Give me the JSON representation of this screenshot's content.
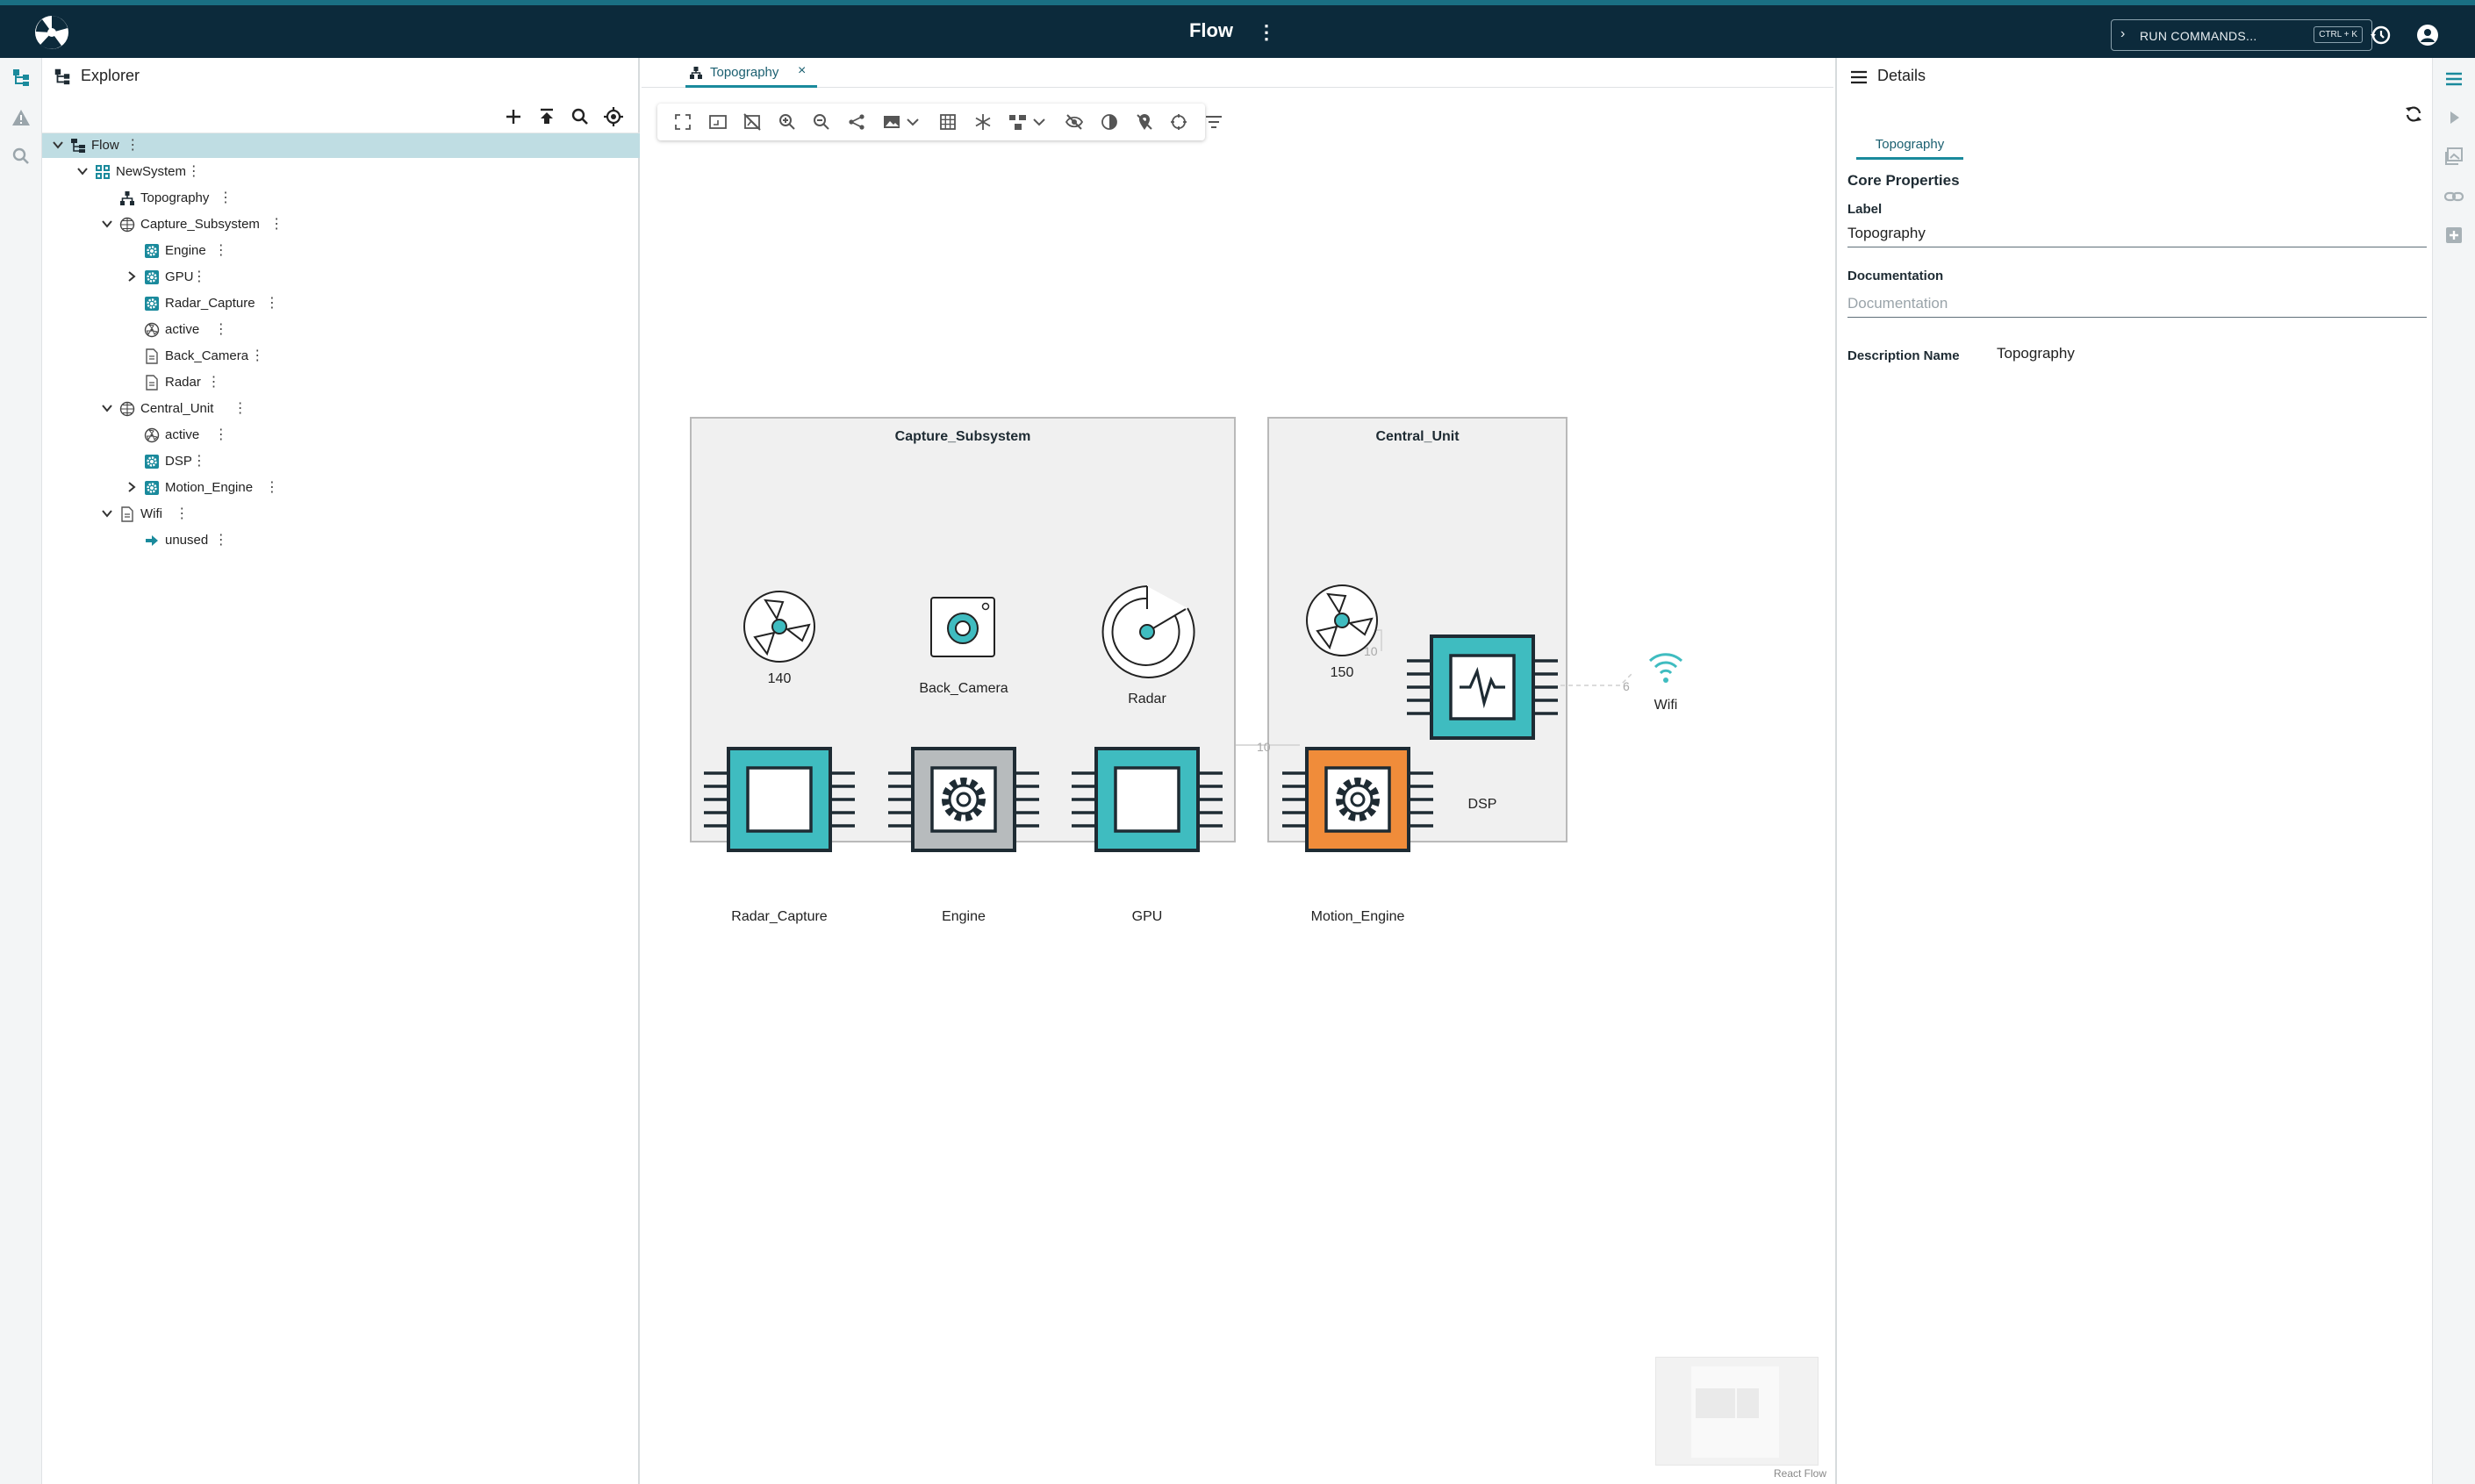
{
  "topbar": {
    "title": "Flow",
    "menu_glyph": "⋮",
    "run_commands_label": "RUN COMMANDS...",
    "run_commands_shortcut": "CTRL + K",
    "logo_icon": "aperture-logo",
    "history_icon": "history-icon",
    "account_icon": "account-circle-icon"
  },
  "left_rail": {
    "items": [
      {
        "name": "explorer-view",
        "icon": "tree-icon",
        "active": true
      },
      {
        "name": "problems-view",
        "icon": "warning-icon",
        "active": false
      },
      {
        "name": "search-view",
        "icon": "search-icon",
        "active": false
      }
    ]
  },
  "explorer": {
    "title": "Explorer",
    "toolbar": [
      "add-icon",
      "collapse-all-icon",
      "search-icon",
      "locate-icon"
    ],
    "tree": [
      {
        "label": "Flow",
        "depth": 0,
        "expanded": true,
        "icon": "flow-icon",
        "selected": true
      },
      {
        "label": "NewSystem",
        "depth": 1,
        "expanded": true,
        "icon": "system-icon"
      },
      {
        "label": "Topography",
        "depth": 2,
        "icon": "topography-icon"
      },
      {
        "label": "Capture_Subsystem",
        "depth": 2,
        "expanded": true,
        "icon": "subsystem-icon"
      },
      {
        "label": "Engine",
        "depth": 3,
        "icon": "gear-icon"
      },
      {
        "label": "GPU",
        "depth": 3,
        "expanded": false,
        "icon": "gear-icon"
      },
      {
        "label": "Radar_Capture",
        "depth": 3,
        "icon": "gear-icon"
      },
      {
        "label": "active",
        "depth": 3,
        "icon": "fan-icon"
      },
      {
        "label": "Back_Camera",
        "depth": 3,
        "icon": "document-icon"
      },
      {
        "label": "Radar",
        "depth": 3,
        "icon": "document-icon"
      },
      {
        "label": "Central_Unit",
        "depth": 2,
        "expanded": true,
        "icon": "subsystem-icon"
      },
      {
        "label": "active",
        "depth": 3,
        "icon": "fan-icon"
      },
      {
        "label": "DSP",
        "depth": 3,
        "icon": "gear-icon"
      },
      {
        "label": "Motion_Engine",
        "depth": 3,
        "expanded": false,
        "icon": "gear-icon"
      },
      {
        "label": "Wifi",
        "depth": 2,
        "expanded": true,
        "icon": "document-icon"
      },
      {
        "label": "unused",
        "depth": 3,
        "icon": "arrow-icon"
      }
    ]
  },
  "editor": {
    "tab_label": "Topography",
    "tab_close": "×",
    "toolbar": [
      "fit-icon",
      "frame-icon",
      "hide-image-icon",
      "zoom-in-icon",
      "zoom-out-icon",
      "share-icon",
      "image-icon",
      "grid-icon",
      "snowflake-icon",
      "layout-icon",
      "visibility-off-icon",
      "contrast-icon",
      "pin-off-icon",
      "target-icon",
      "filter-icon"
    ],
    "react_flow_label": "React Flow"
  },
  "diagram": {
    "groups": [
      {
        "label": "Capture_Subsystem"
      },
      {
        "label": "Central_Unit"
      }
    ],
    "nodes": [
      {
        "label": "140",
        "kind": "fan"
      },
      {
        "label": "Back_Camera",
        "kind": "camera"
      },
      {
        "label": "Radar",
        "kind": "radar"
      },
      {
        "label": "Radar_Capture",
        "kind": "chip-empty",
        "color": "#3fbcc0"
      },
      {
        "label": "Engine",
        "kind": "chip-gear",
        "color": "#b7bbbd"
      },
      {
        "label": "GPU",
        "kind": "chip-empty",
        "color": "#3fbcc0"
      },
      {
        "label": "150",
        "kind": "fan"
      },
      {
        "label": "DSP",
        "kind": "chip-wave",
        "color": "#3fbcc0"
      },
      {
        "label": "Motion_Engine",
        "kind": "chip-gear",
        "color": "#f08c3a"
      },
      {
        "label": "Wifi",
        "kind": "wifi"
      }
    ],
    "edge_labels": [
      "10",
      "10",
      "6"
    ]
  },
  "details": {
    "title": "Details",
    "tab": "Topography",
    "section": "Core Properties",
    "label_caption": "Label",
    "label_value": "Topography",
    "documentation_caption": "Documentation",
    "documentation_placeholder": "Documentation",
    "description_name_caption": "Description Name",
    "description_name_value": "Topography"
  },
  "right_rail": {
    "items": [
      "menu-icon",
      "play-icon",
      "gallery-icon",
      "link-icon",
      "add-box-icon"
    ]
  },
  "colors": {
    "topbar": "#0c2a3b",
    "accent": "#1a8a9c",
    "chip_teal": "#3fbcc0",
    "chip_gray": "#b7bbbd",
    "chip_orange": "#f08c3a",
    "selection": "#bfdde3"
  }
}
